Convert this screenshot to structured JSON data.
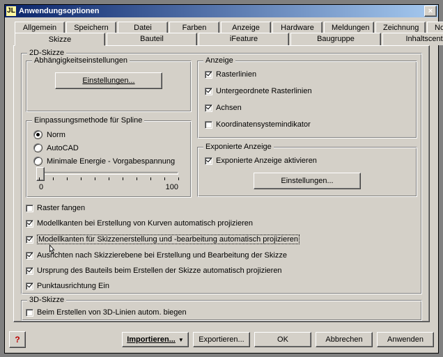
{
  "window": {
    "title": "Anwendungsoptionen"
  },
  "tabs": {
    "row1": [
      "Allgemein",
      "Speichern",
      "Datei",
      "Farben",
      "Anzeige",
      "Hardware",
      "Meldungen",
      "Zeichnung",
      "Notizblock"
    ],
    "row2": [
      "Skizze",
      "Bauteil",
      "iFeature",
      "Baugruppe",
      "Inhaltscenter"
    ],
    "selected": "Skizze"
  },
  "panel": {
    "group_2d": "2D-Skizze",
    "constraints": {
      "legend": "Abhängigkeitseinstellungen",
      "settings_btn": "Einstellungen..."
    },
    "spline": {
      "legend": "Einpassungsmethode für Spline",
      "opt_norm": "Norm",
      "opt_autocad": "AutoCAD",
      "opt_min_energy": "Minimale Energie - Vorgabespannung",
      "slider_min": "0",
      "slider_max": "100"
    },
    "display": {
      "legend": "Anzeige",
      "gridlines": "Rasterlinien",
      "sub_gridlines": "Untergeordnete Rasterlinien",
      "axes": "Achsen",
      "csys": "Koordinatensystemindikator"
    },
    "exposed": {
      "legend": "Exponierte Anzeige",
      "activate": "Exponierte Anzeige aktivieren",
      "settings_btn": "Einstellungen..."
    },
    "checks": {
      "snap_grid": "Raster fangen",
      "auto_project_curves": "Modellkanten bei Erstellung von Kurven automatisch projizieren",
      "auto_project_sketch": "Modellkanten für Skizzenerstellung und -bearbeitung automatisch projizieren",
      "align_sketch_plane": "Ausrichten nach Skizzierebene bei Erstellung und Bearbeitung der Skizze",
      "project_origin": "Ursprung des Bauteils beim Erstellen der Skizze automatisch projizieren",
      "point_align": "Punktausrichtung Ein"
    },
    "group_3d": "3D-Skizze",
    "bend_3d": "Beim Erstellen von 3D-Linien autom. biegen"
  },
  "footer": {
    "import": "Importieren...",
    "export": "Exportieren...",
    "ok": "OK",
    "cancel": "Abbrechen",
    "apply": "Anwenden"
  },
  "icons": {
    "close": "×",
    "help": "?",
    "app": "JL",
    "dropdown": "▼"
  }
}
